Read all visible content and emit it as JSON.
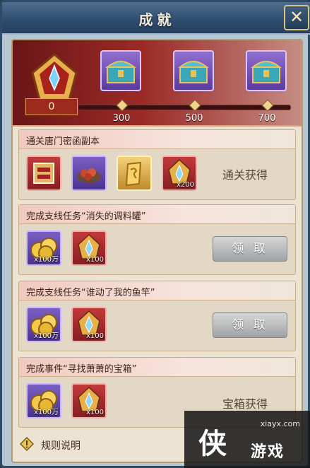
{
  "window": {
    "title": "成就",
    "close_glyph": "✕"
  },
  "header": {
    "score": "0",
    "milestones": [
      "300",
      "500",
      "700"
    ],
    "accent": "#9b2a27"
  },
  "sections": [
    {
      "title": "通关唐门密函副本",
      "items": [
        {
          "icon": "badge-reward-icon",
          "qty": ""
        },
        {
          "icon": "food-plate-icon",
          "qty": ""
        },
        {
          "icon": "golden-scroll-icon",
          "qty": ""
        },
        {
          "icon": "gem-crest-icon",
          "qty": "x200"
        }
      ],
      "action_text": "通关获得"
    },
    {
      "title": "完成支线任务“消失的调料罐”",
      "items": [
        {
          "icon": "gold-coins-icon",
          "qty": "x100万"
        },
        {
          "icon": "gem-crest-icon",
          "qty": "x100"
        }
      ],
      "action_button": "领 取"
    },
    {
      "title": "完成支线任务“谁动了我的鱼竿”",
      "items": [
        {
          "icon": "gold-coins-icon",
          "qty": "x100万"
        },
        {
          "icon": "gem-crest-icon",
          "qty": "x100"
        }
      ],
      "action_button": "领 取"
    },
    {
      "title": "完成事件“寻找萧萧的宝箱”",
      "items": [
        {
          "icon": "gold-coins-icon",
          "qty": "x100万"
        },
        {
          "icon": "gem-crest-icon",
          "qty": "x100"
        }
      ],
      "action_text": "宝箱获得"
    }
  ],
  "footer": {
    "rules_label": "规则说明"
  },
  "watermark": {
    "url": "xiayx.com",
    "big": "侠",
    "small": "游戏"
  }
}
